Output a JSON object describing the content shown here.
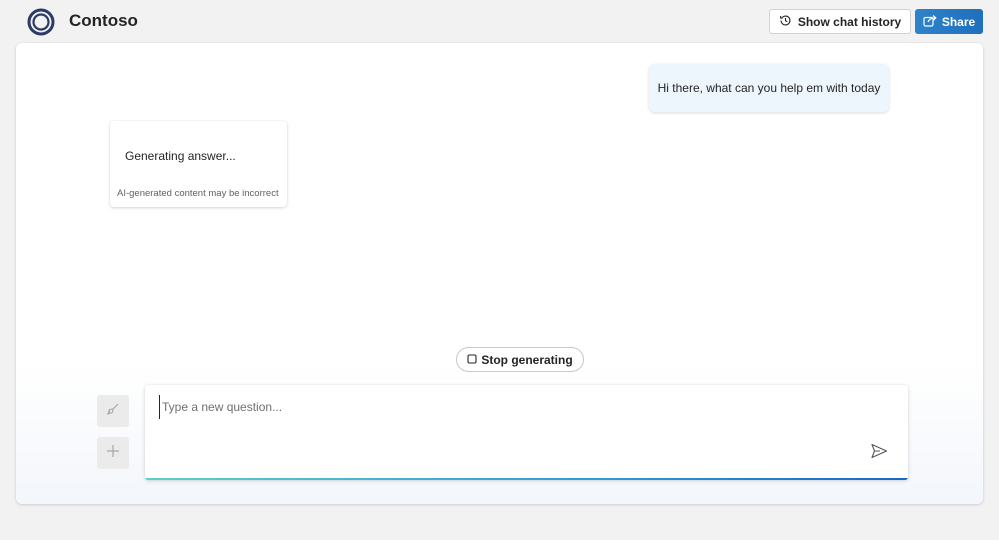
{
  "header": {
    "app_title": "Contoso",
    "history_button_label": "Show chat history",
    "share_button_label": "Share",
    "share_color": "#1f6fbd"
  },
  "chat": {
    "user_message": "Hi there, what can you help em with today",
    "assistant_status": "Generating answer...",
    "disclaimer": "AI-generated content may be incorrect",
    "stop_button_label": "Stop generating"
  },
  "composer": {
    "placeholder": "Type a new question...",
    "value": "",
    "icons": [
      "broom-icon",
      "plus-icon",
      "send-icon"
    ]
  }
}
